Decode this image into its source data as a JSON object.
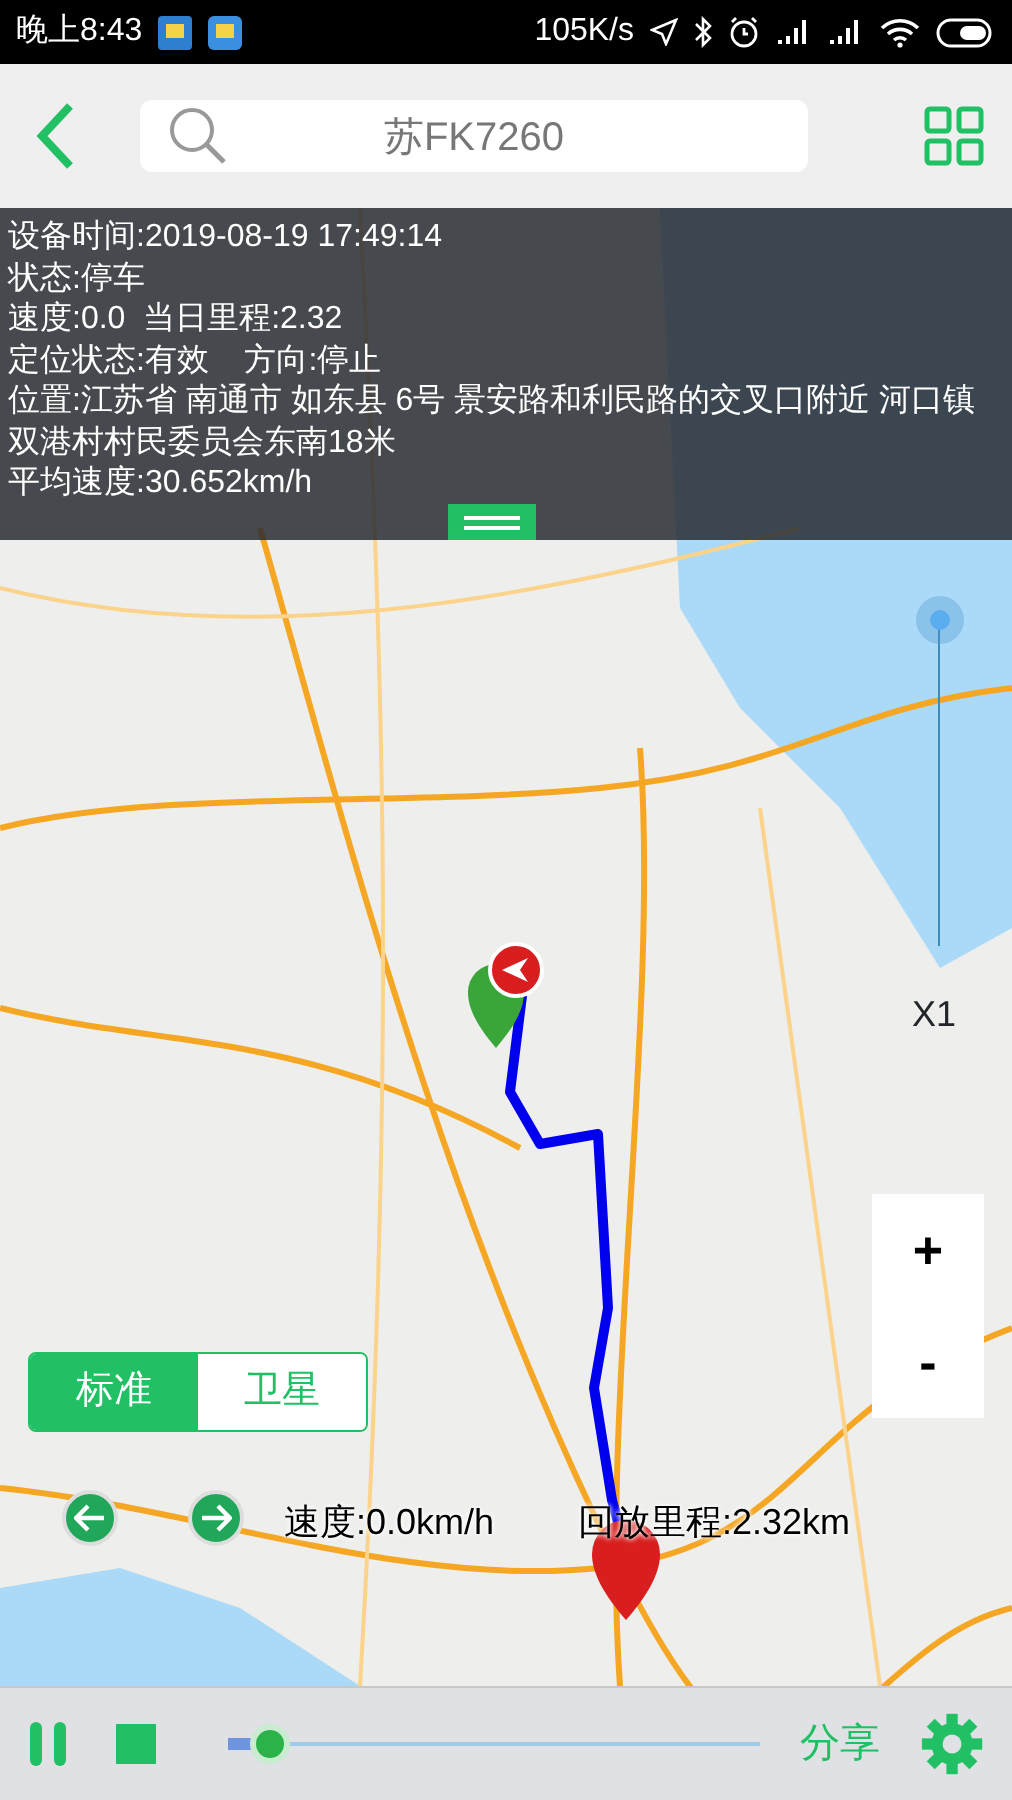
{
  "status_bar": {
    "time": "晚上8:43",
    "network_speed": "105K/s"
  },
  "header": {
    "search_value": "苏FK7260"
  },
  "info_panel": {
    "lines": [
      "设备时间:2019-08-19 17:49:14",
      "状态:停车",
      "速度:0.0  当日里程:2.32",
      "定位状态:有效    方向:停止",
      "位置:江苏省 南通市 如东县 6号 景安路和利民路的交叉口附近 河口镇双港村村民委员会东南18米",
      "平均速度:30.652km/h"
    ]
  },
  "playback_speed": {
    "label": "X1",
    "level": 1
  },
  "zoom": {
    "in": "+",
    "out": "-"
  },
  "map_types": [
    {
      "label": "标准",
      "selected": true
    },
    {
      "label": "卫星",
      "selected": false
    }
  ],
  "playback_info": {
    "speed": "速度:0.0km/h",
    "mileage": "回放里程:2.32km"
  },
  "controls": {
    "playing": true,
    "progress": {
      "level": 0.08
    },
    "share": "分享"
  }
}
